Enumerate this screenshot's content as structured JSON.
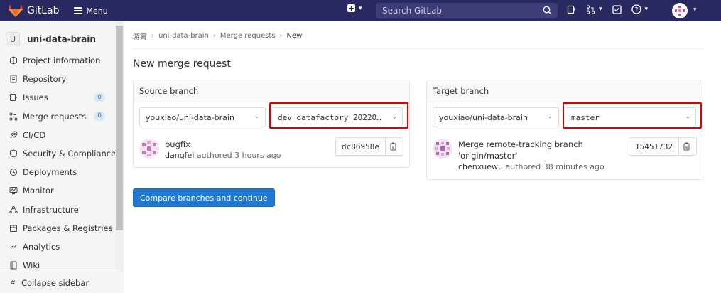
{
  "navbar": {
    "brand": "GitLab",
    "menu_label": "Menu",
    "search_placeholder": "Search GitLab"
  },
  "sidebar": {
    "project_initial": "U",
    "project_name": "uni-data-brain",
    "items": [
      {
        "label": "Project information",
        "icon": "info-icon"
      },
      {
        "label": "Repository",
        "icon": "document-icon"
      },
      {
        "label": "Issues",
        "icon": "issues-icon",
        "badge": "0"
      },
      {
        "label": "Merge requests",
        "icon": "merge-request-icon",
        "badge": "0"
      },
      {
        "label": "CI/CD",
        "icon": "rocket-icon"
      },
      {
        "label": "Security & Compliance",
        "icon": "shield-icon"
      },
      {
        "label": "Deployments",
        "icon": "deployments-icon"
      },
      {
        "label": "Monitor",
        "icon": "monitor-icon"
      },
      {
        "label": "Infrastructure",
        "icon": "infrastructure-icon"
      },
      {
        "label": "Packages & Registries",
        "icon": "package-icon"
      },
      {
        "label": "Analytics",
        "icon": "chart-icon"
      },
      {
        "label": "Wiki",
        "icon": "book-icon"
      }
    ],
    "collapse_label": "Collapse sidebar"
  },
  "breadcrumb": [
    "游霄",
    "uni-data-brain",
    "Merge requests",
    "New"
  ],
  "page_title": "New merge request",
  "source": {
    "heading": "Source branch",
    "project": "youxiao/uni-data-brain",
    "branch": "dev_datafactory_20220…",
    "commit_title": "bugfix",
    "author": "dangfei",
    "authored_text": "authored 3 hours ago",
    "sha": "dc86958e"
  },
  "target": {
    "heading": "Target branch",
    "project": "youxiao/uni-data-brain",
    "branch": "master",
    "commit_title_line1": "Merge remote-tracking branch",
    "commit_title_line2": "'origin/master'",
    "author": "chenxuewu",
    "authored_text": "authored 38 minutes ago",
    "sha": "15451732"
  },
  "compare_button": "Compare branches and continue",
  "colors": {
    "navbar": "#292961",
    "primary": "#1f78d1",
    "highlight": "#e00000"
  }
}
